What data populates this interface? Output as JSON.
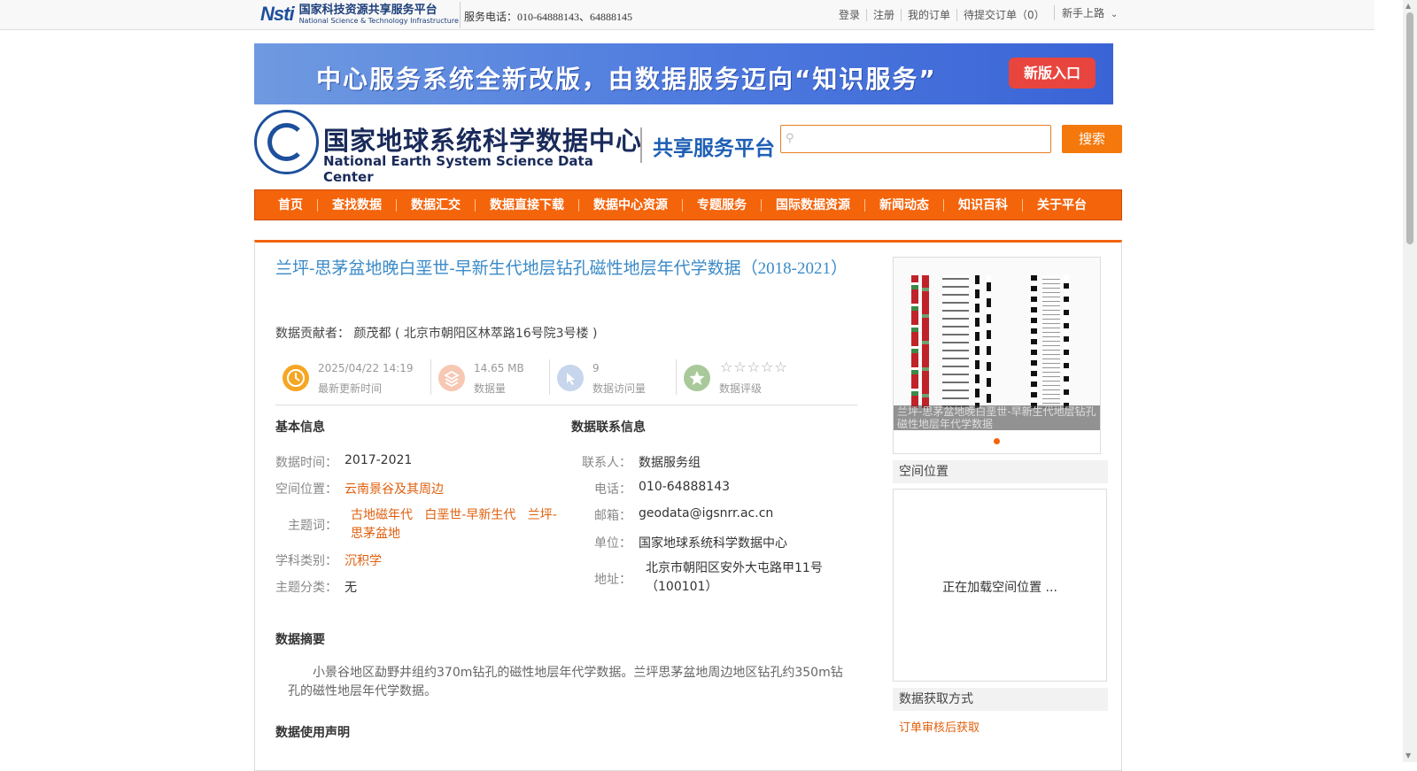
{
  "topbar": {
    "logo_mark": "Nsti",
    "logo_cn": "国家科技资源共享服务平台",
    "logo_en": "National Science & Technology Infrastructure",
    "phone": "服务电话：010-64888143、64888145",
    "links": [
      "登录",
      "注册",
      "我的订单",
      "待提交订单（0）"
    ],
    "guide": "新手上路"
  },
  "banner": {
    "text": "中心服务系统全新改版，由数据服务迈向“知识服务”",
    "button": "新版入口"
  },
  "header": {
    "logo_cn": "国家地球系统科学数据中心",
    "logo_en": "National Earth System Science Data Center",
    "platform": "共享服务平台",
    "search_placeholder": "",
    "search_button": "搜索"
  },
  "nav": [
    "首页",
    "查找数据",
    "数据汇交",
    "数据直接下载",
    "数据中心资源",
    "专题服务",
    "国际数据资源",
    "新闻动态",
    "知识百科",
    "关于平台"
  ],
  "dataset": {
    "title": "兰坪-思茅盆地晚白垩世-早新生代地层钻孔磁性地层年代学数据（2018-2021）",
    "contributor_label": "数据贡献者：",
    "contributor": "颜茂都 ( 北京市朝阳区林萃路16号院3号楼 )",
    "stats": [
      {
        "value": "2025/04/22 14:19",
        "label": "最新更新时间",
        "icon": "clock-icon",
        "color": "#f5a623"
      },
      {
        "value": "14.65 MB",
        "label": "数据量",
        "icon": "layers-icon",
        "color": "#f6c8b4"
      },
      {
        "value": "9",
        "label": "数据访问量",
        "icon": "pointer-icon",
        "color": "#c7d6ec"
      },
      {
        "value": "",
        "label": "数据评级",
        "icon": "star-badge-icon",
        "color": "#a9c99a"
      }
    ],
    "rating_stars": "☆☆☆☆☆"
  },
  "basic_info": {
    "title": "基本信息",
    "time_label": "数据时间：",
    "time": "2017-2021",
    "space_label": "空间位置：",
    "space": "云南景谷及其周边",
    "keywords_label": "主题词：",
    "keywords": [
      "古地磁年代",
      "白垩世-早新生代",
      "兰坪-",
      "思茅盆地"
    ],
    "subject_label": "学科类别：",
    "subject": "沉积学",
    "category_label": "主题分类：",
    "category": "无"
  },
  "contact_info": {
    "title": "数据联系信息",
    "person_label": "联系人：",
    "person": "数据服务组",
    "phone_label": "电话：",
    "phone": "010-64888143",
    "email_label": "邮箱：",
    "email": "geodata@igsnrr.ac.cn",
    "unit_label": "单位：",
    "unit": "国家地球系统科学数据中心",
    "address_label": "地址：",
    "address1": "北京市朝阳区安外大屯路甲11号",
    "address2": "（100101）"
  },
  "abstract": {
    "title": "数据摘要",
    "text": "小景谷地区勐野井组约370m钻孔的磁性地层年代学数据。兰坪思茅盆地周边地区钻孔约350m钻孔的磁性地层年代学数据。"
  },
  "usage": {
    "title": "数据使用声明"
  },
  "sidebar": {
    "thumb_caption": "兰坪-思茅盆地晚白垩世-早新生代地层钻孔磁性地层年代学数据",
    "space_title": "空间位置",
    "map_loading": "正在加载空间位置 ...",
    "access_title": "数据获取方式",
    "access_link": "订单审核后获取"
  }
}
